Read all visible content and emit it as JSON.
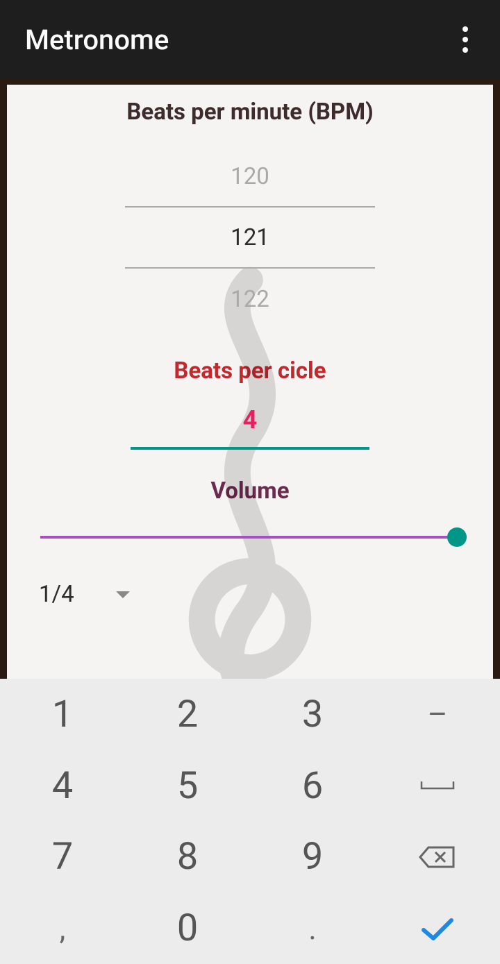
{
  "app": {
    "title": "Metronome"
  },
  "bpm": {
    "label": "Beats per minute (BPM)",
    "prev": "120",
    "current": "121",
    "next": "122"
  },
  "cycle": {
    "label": "Beats per cicle",
    "value": "4"
  },
  "volume": {
    "label": "Volume",
    "percent": 100
  },
  "note_value": {
    "selected": "1/4"
  },
  "keypad": {
    "k1": "1",
    "k2": "2",
    "k3": "3",
    "k4": "4",
    "k5": "5",
    "k6": "6",
    "k7": "7",
    "k8": "8",
    "k9": "9",
    "comma": ",",
    "k0": "0",
    "dot": ".",
    "dash": "–"
  }
}
